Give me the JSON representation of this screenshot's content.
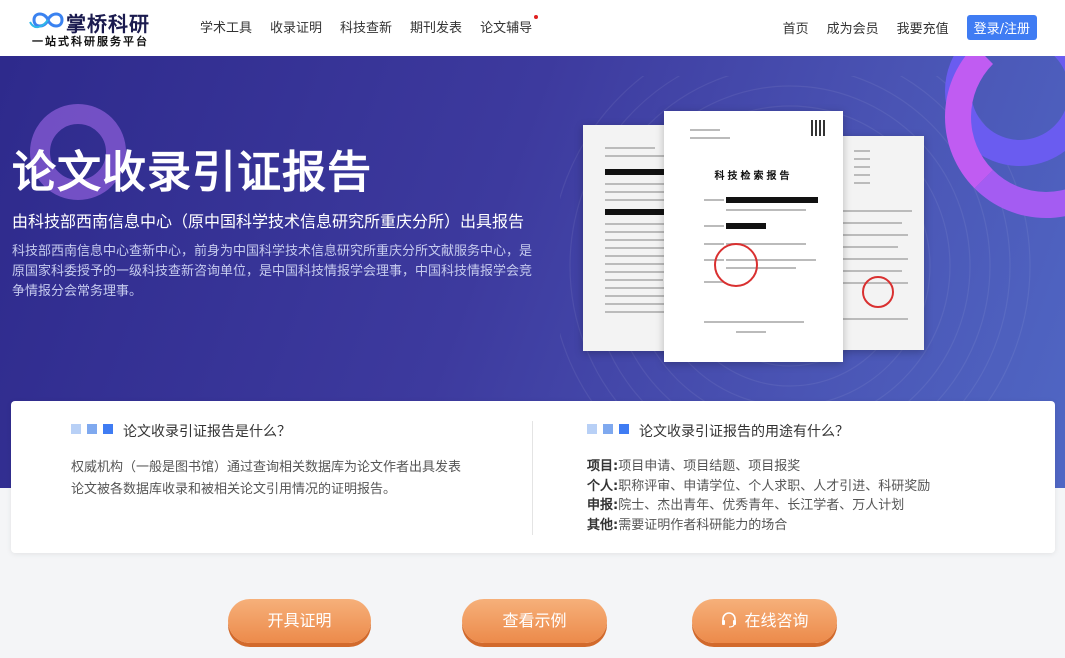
{
  "logo": {
    "title": "掌桥科研",
    "subtitle": "一站式科研服务平台"
  },
  "nav": {
    "items": [
      "学术工具",
      "收录证明",
      "科技查新",
      "期刊发表",
      "论文辅导"
    ],
    "right": [
      "首页",
      "成为会员",
      "我要充值"
    ],
    "login_label": "登录/注册"
  },
  "hero": {
    "title": "论文收录引证报告",
    "subtitle": "由科技部西南信息中心（原中国科学技术信息研究所重庆分所）出具报告",
    "description": "科技部西南信息中心查新中心，前身为中国科学技术信息研究所重庆分所文献服务中心，是原国家科委授予的一级科技查新咨询单位，是中国科技情报学会理事，中国科技情报学会竞争情报分会常务理事。",
    "doc_title": "科技检索报告"
  },
  "card": {
    "left_heading": "论文收录引证报告是什么？",
    "left_body": "权威机构（一般是图书馆）通过查询相关数据库为论文作者出具发表论文被各数据库收录和被相关论文引用情况的证明报告。",
    "right_heading": "论文收录引证报告的用途有什么？",
    "uses": [
      {
        "label": "项目:",
        "text": "项目申请、项目结题、项目报奖"
      },
      {
        "label": "个人:",
        "text": "职称评审、申请学位、个人求职、人才引进、科研奖励"
      },
      {
        "label": "申报:",
        "text": "院士、杰出青年、优秀青年、长江学者、万人计划"
      },
      {
        "label": "其他:",
        "text": "需要证明作者科研能力的场合"
      }
    ]
  },
  "buttons": {
    "certify": "开具证明",
    "sample": "查看示例",
    "consult": "在线咨询"
  },
  "colors": {
    "accent": "#3f7cf3",
    "button": "#ec8a4a",
    "hero_bg": "#3d3a9e"
  }
}
